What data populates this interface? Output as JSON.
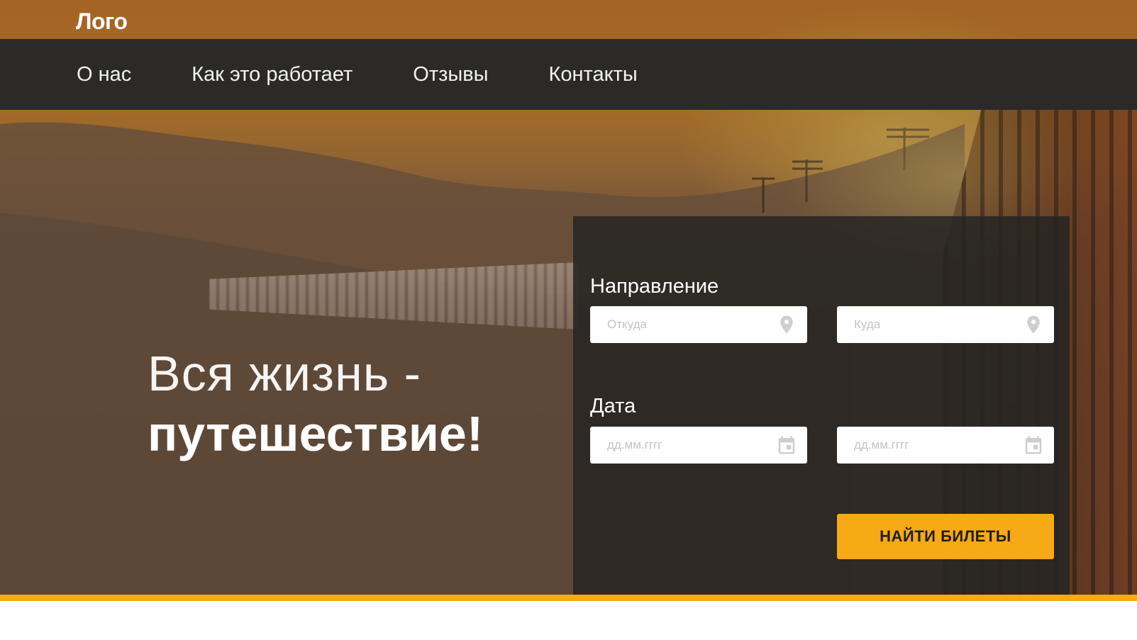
{
  "header": {
    "logo_text": "Лого"
  },
  "nav": {
    "items": [
      {
        "label": "О нас"
      },
      {
        "label": "Как это работает"
      },
      {
        "label": "Отзывы"
      },
      {
        "label": "Контакты"
      }
    ]
  },
  "hero": {
    "title_line1": "Вся жизнь -",
    "title_line2": "путешествие!"
  },
  "search": {
    "direction_label": "Направление",
    "from_placeholder": "Откуда",
    "to_placeholder": "Куда",
    "date_label": "Дата",
    "date_from_placeholder": "дд.мм.гггг",
    "date_to_placeholder": "дд.мм.гггг",
    "submit_label": "НАЙТИ БИЛЕТЫ"
  },
  "icons": {
    "location": "map-pin-icon",
    "calendar": "calendar-icon"
  },
  "colors": {
    "accent": "#f7a916",
    "navbar": "#2b2a28",
    "panel": "#262422"
  }
}
